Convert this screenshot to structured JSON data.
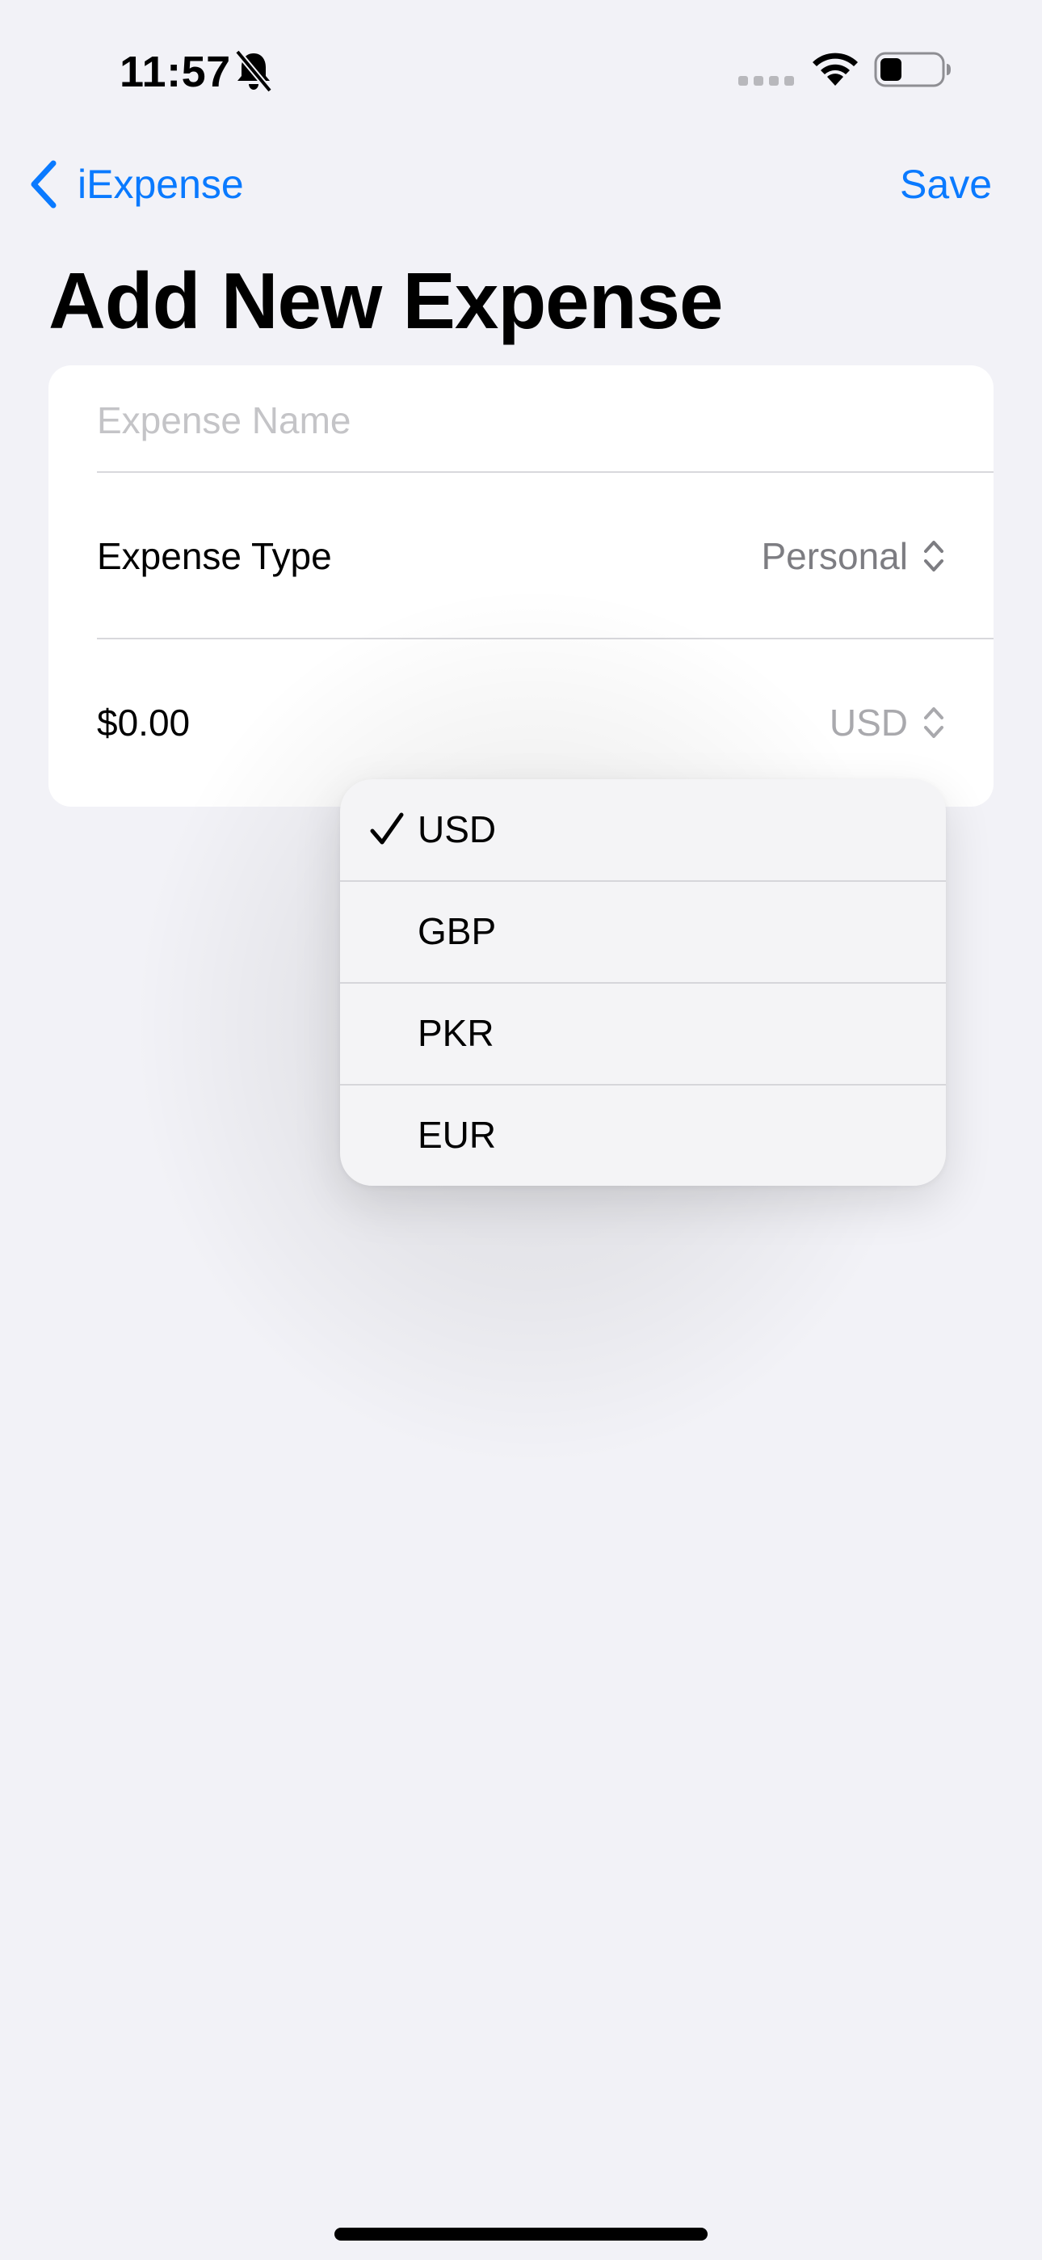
{
  "status_bar": {
    "time": "11:57",
    "icons": [
      "bell-slash-icon",
      "cellular-signal-icon",
      "wifi-icon",
      "battery-icon"
    ]
  },
  "nav": {
    "back_label": "iExpense",
    "save_label": "Save",
    "accent_color": "#0a7aff"
  },
  "page": {
    "title": "Add New Expense"
  },
  "form": {
    "name_placeholder": "Expense Name",
    "name_value": "",
    "type_label": "Expense Type",
    "type_value": "Personal",
    "amount_value": "$0.00",
    "currency_value": "USD"
  },
  "currency_menu": {
    "items": [
      {
        "label": "USD",
        "selected": true
      },
      {
        "label": "GBP",
        "selected": false
      },
      {
        "label": "PKR",
        "selected": false
      },
      {
        "label": "EUR",
        "selected": false
      }
    ]
  }
}
